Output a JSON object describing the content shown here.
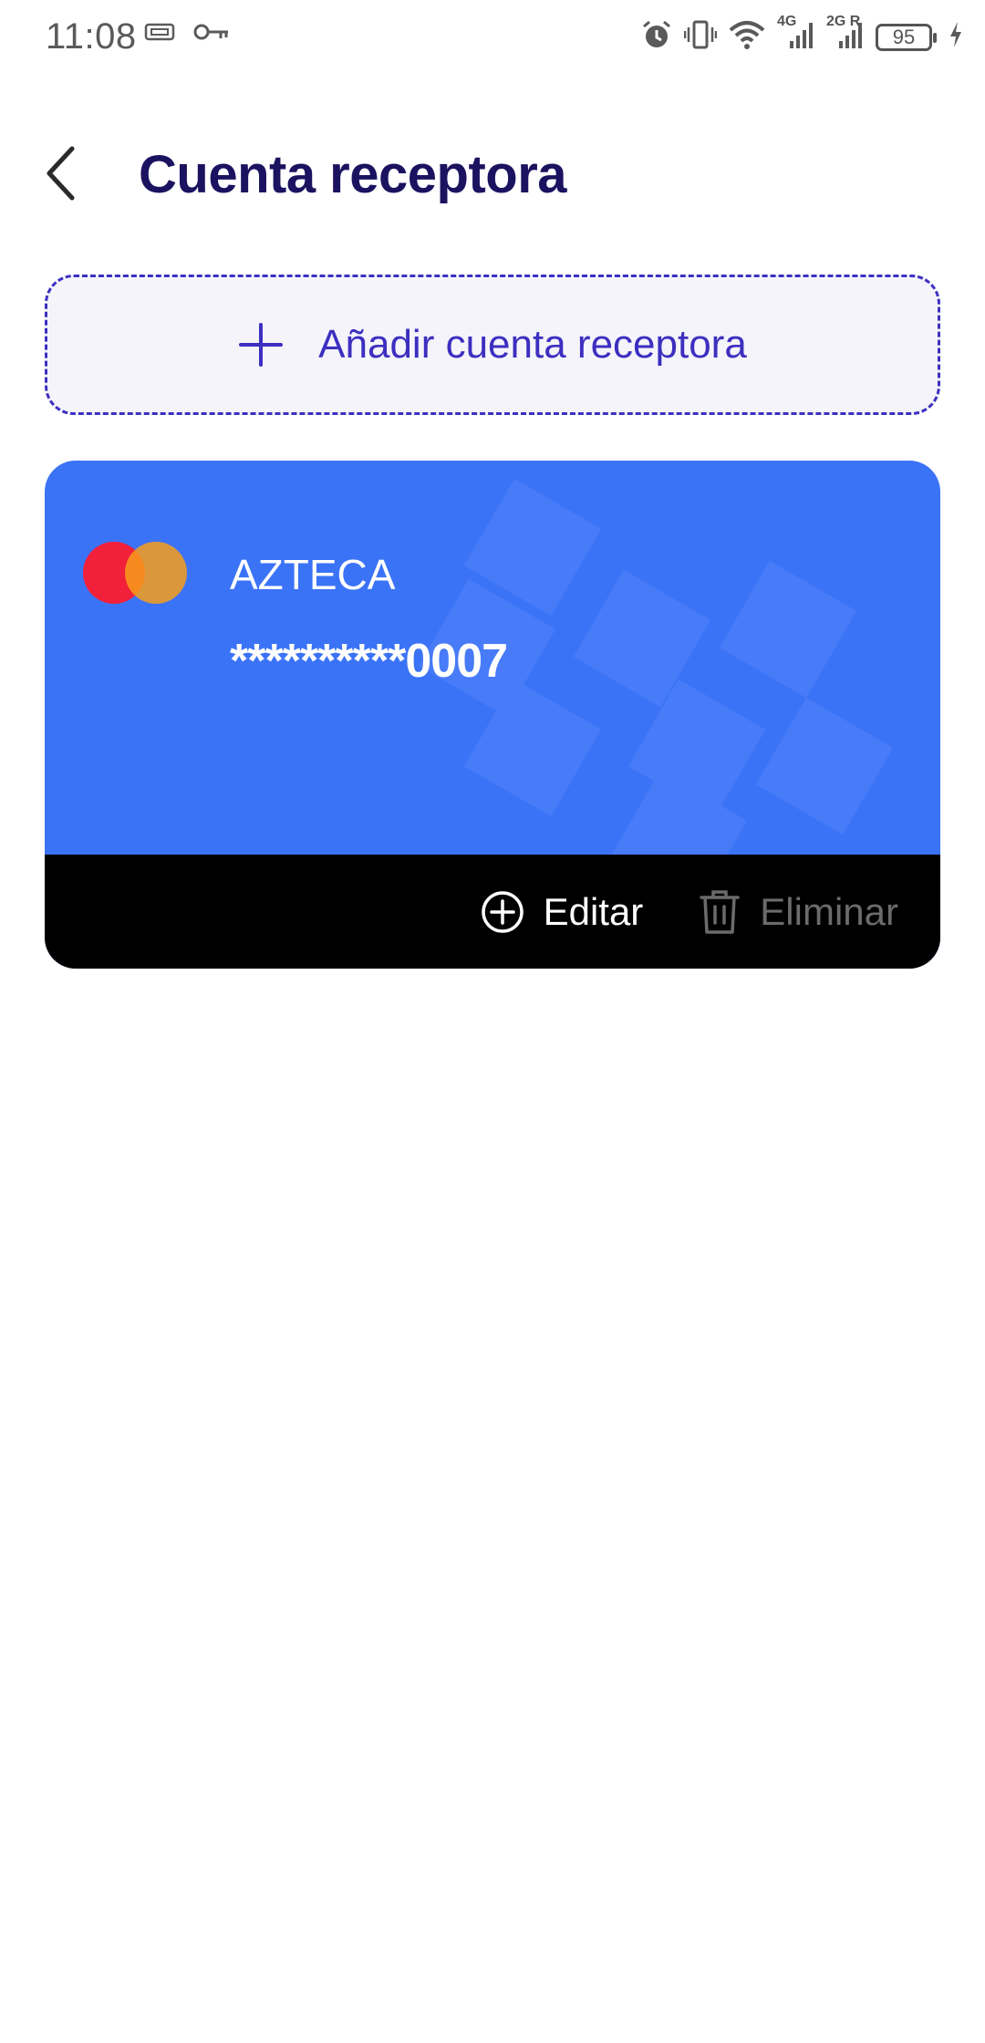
{
  "status_bar": {
    "time": "11:08",
    "battery": "95",
    "network_1": "4G",
    "network_2": "2G R",
    "icons": [
      "sim-card-icon",
      "key-icon",
      "alarm-icon",
      "vibrate-icon",
      "wifi-icon",
      "signal-icon",
      "signal-icon",
      "battery-icon",
      "charging-icon"
    ]
  },
  "header": {
    "title": "Cuenta receptora",
    "back_icon": "chevron-left-icon"
  },
  "add_account": {
    "label": "Añadir cuenta receptora",
    "icon": "plus-icon",
    "accent": "#3d2fc0"
  },
  "card": {
    "bank": "AZTECA",
    "masked_number": "**********",
    "last_digits": "0007",
    "brand_icon": "mastercard-logo-icon",
    "background": "#3b73f7",
    "actions": {
      "edit_label": "Editar",
      "delete_label": "Eliminar"
    }
  }
}
